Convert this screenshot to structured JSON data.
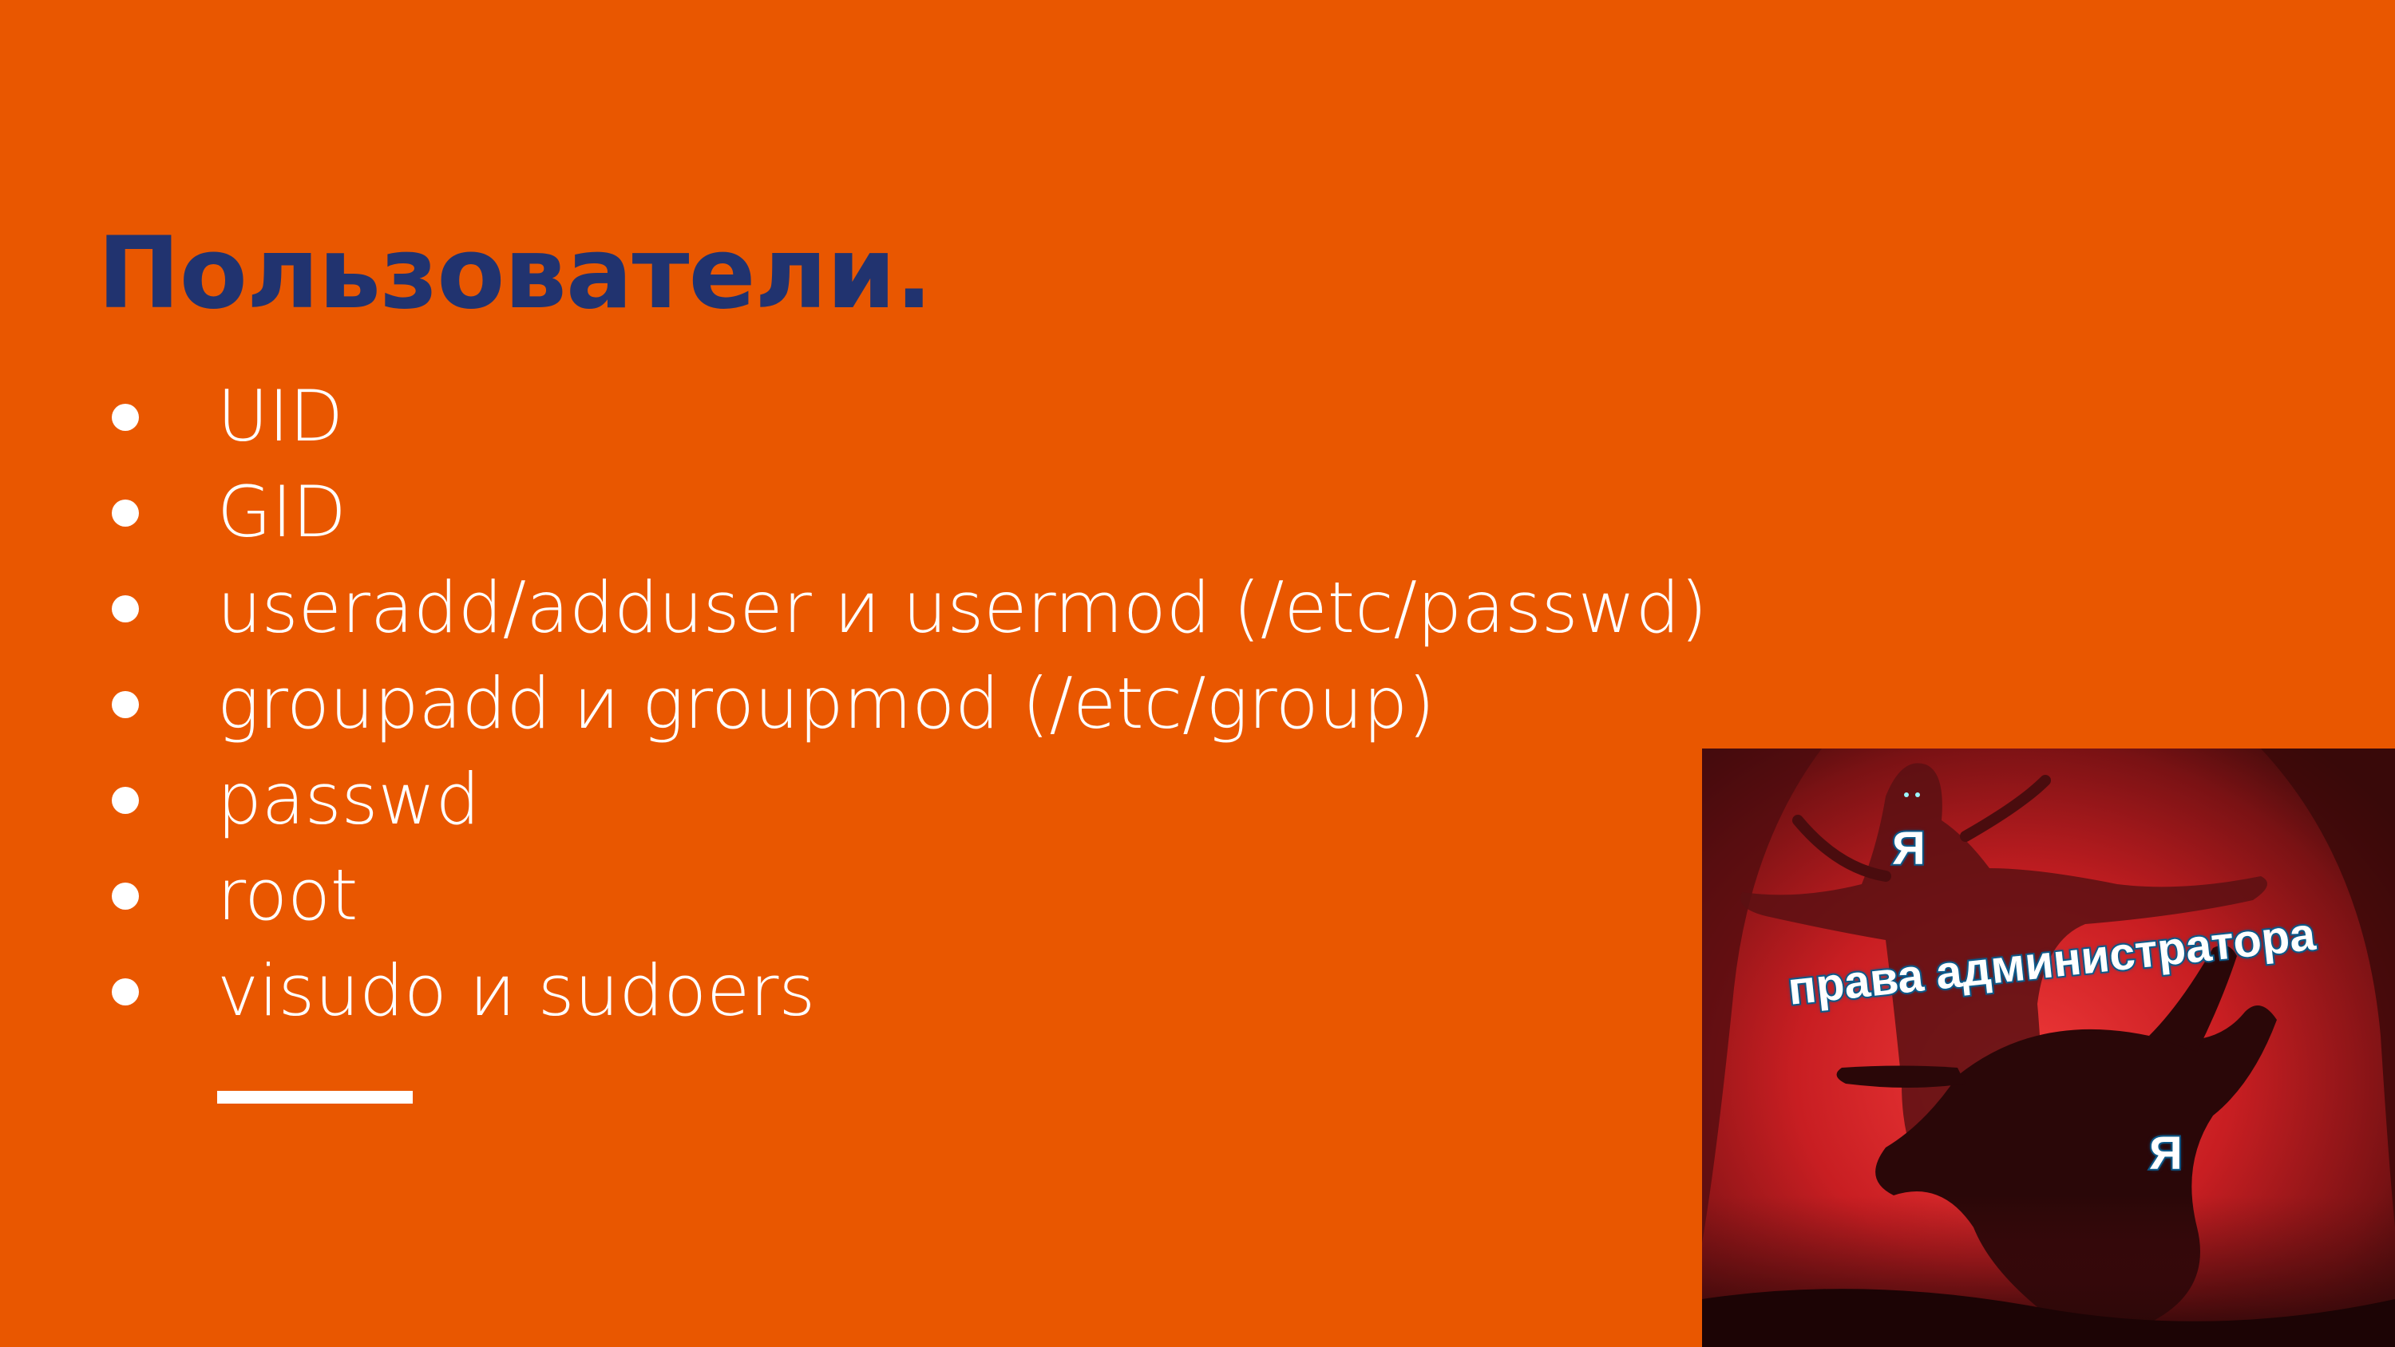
{
  "slide": {
    "title": "Пользователи.",
    "bullets": [
      "UID",
      "GID",
      "useradd/adduser и usermod (/etc/passwd)",
      "groupadd и groupmod (/etc/group)",
      "passwd",
      "root",
      "visudo и sudoers"
    ],
    "colors": {
      "background": "#e95700",
      "title": "#21336f",
      "text": "#ffffff"
    }
  },
  "meme": {
    "label_top": "Я",
    "label_middle": "права администратора",
    "label_bottom": "Я"
  }
}
